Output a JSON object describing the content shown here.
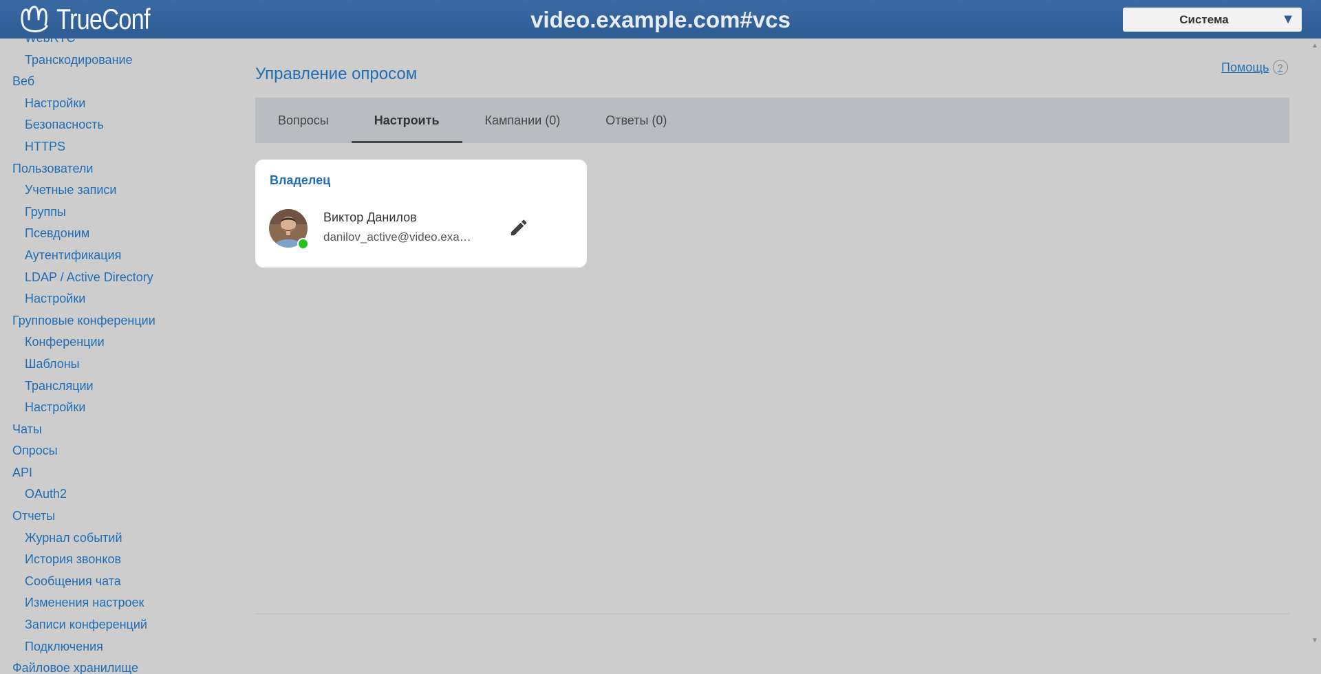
{
  "header": {
    "logo_text": "TrueConf",
    "site_title": "video.example.com#vcs",
    "system_select": "Система"
  },
  "sidebar": {
    "items": [
      {
        "label": "WebRTC",
        "level": 1
      },
      {
        "label": "Транскодирование",
        "level": 1
      },
      {
        "label": "Веб",
        "level": 0
      },
      {
        "label": "Настройки",
        "level": 1
      },
      {
        "label": "Безопасность",
        "level": 1
      },
      {
        "label": "HTTPS",
        "level": 1
      },
      {
        "label": "Пользователи",
        "level": 0
      },
      {
        "label": "Учетные записи",
        "level": 1
      },
      {
        "label": "Группы",
        "level": 1
      },
      {
        "label": "Псевдоним",
        "level": 1
      },
      {
        "label": "Аутентификация",
        "level": 1
      },
      {
        "label": "LDAP / Active Directory",
        "level": 1
      },
      {
        "label": "Настройки",
        "level": 1
      },
      {
        "label": "Групповые конференции",
        "level": 0
      },
      {
        "label": "Конференции",
        "level": 1
      },
      {
        "label": "Шаблоны",
        "level": 1
      },
      {
        "label": "Трансляции",
        "level": 1
      },
      {
        "label": "Настройки",
        "level": 1
      },
      {
        "label": "Чаты",
        "level": 0
      },
      {
        "label": "Опросы",
        "level": 0
      },
      {
        "label": "API",
        "level": 0
      },
      {
        "label": "OAuth2",
        "level": 1
      },
      {
        "label": "Отчеты",
        "level": 0
      },
      {
        "label": "Журнал событий",
        "level": 1
      },
      {
        "label": "История звонков",
        "level": 1
      },
      {
        "label": "Сообщения чата",
        "level": 1
      },
      {
        "label": "Изменения настроек",
        "level": 1
      },
      {
        "label": "Записи конференций",
        "level": 1
      },
      {
        "label": "Подключения",
        "level": 1
      },
      {
        "label": "Файловое хранилище",
        "level": 0
      }
    ]
  },
  "main": {
    "title": "Управление опросом",
    "help_label": "Помощь",
    "help_icon": "?",
    "tabs": [
      {
        "label": "Вопросы",
        "active": false
      },
      {
        "label": "Настроить",
        "active": true
      },
      {
        "label": "Кампании (0)",
        "active": false
      },
      {
        "label": "Ответы (0)",
        "active": false
      }
    ],
    "owner_card": {
      "title": "Владелец",
      "name": "Виктор Данилов",
      "email": "danilov_active@video.example.com",
      "status": "online"
    }
  },
  "colors": {
    "header_bg": "#2e5b93",
    "link": "#1f6db3",
    "presence_online": "#21c321"
  }
}
